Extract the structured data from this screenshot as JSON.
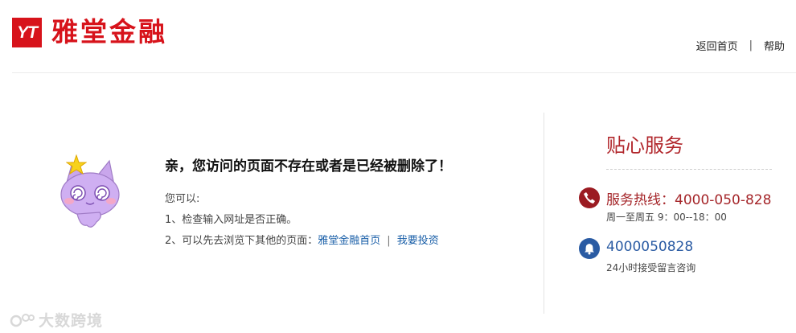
{
  "header": {
    "logo_mark": "YT",
    "logo_text": "雅堂金融",
    "nav": {
      "home": "返回首页",
      "separator": "|",
      "help": "帮助"
    }
  },
  "main": {
    "title": "亲，您访问的页面不存在或者是已经被删除了！",
    "subtitle": "您可以:",
    "line1": "1、检查输入网址是否正确。",
    "line2_prefix": "2、可以先去浏览下其他的页面：",
    "link_home": "雅堂金融首页",
    "link_separator": "|",
    "link_invest": "我要投资"
  },
  "service": {
    "title": "贴心服务",
    "hotline": "服务热线：4000-050-828",
    "hours": "周一至周五 9：00--18：00",
    "number": "4000050828",
    "message": "24小时接受留言咨询"
  },
  "watermark": {
    "text": "大数跨境"
  },
  "colors": {
    "brand_red": "#d7131b",
    "service_red": "#a5262a",
    "link_blue": "#1a5fa8",
    "bell_blue": "#2a5ba3"
  },
  "icons": [
    "phone-icon",
    "bell-icon",
    "cat-mascot-icon",
    "star-icon"
  ]
}
